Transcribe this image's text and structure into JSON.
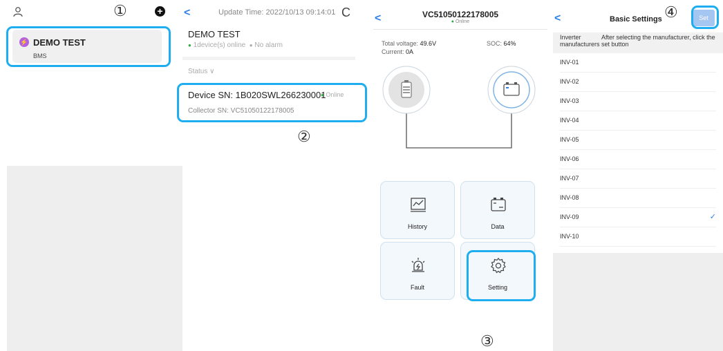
{
  "colors": {
    "accent": "#2b7de9",
    "highlight": "#1eaef0",
    "online_green": "#2fa845",
    "set_button": "#a6c6f2",
    "plant_badge": "#b560e0"
  },
  "annotations": [
    "①",
    "②",
    "③",
    "④"
  ],
  "plant_list": {
    "user_icon": "user-icon",
    "add_icon": "+",
    "plant": {
      "badge_icon": "⚡",
      "name": "DEMO TEST",
      "type": "BMS"
    }
  },
  "plant_detail": {
    "back": "<",
    "update_time_label": "Update Time: 2022/10/13 09:14:01",
    "refresh_icon": "C",
    "title": "DEMO TEST",
    "online_dot": "●",
    "devices_online": "1device(s) online",
    "alarm_dot": "●",
    "alarm": "No alarm",
    "status_label": "Status ∨",
    "device_sn_label": "Device SN:  1B020SWL266230001",
    "device_dot": "●",
    "device_status": "Online",
    "collector_sn_label": "Collector SN:  VC51050122178005"
  },
  "collector": {
    "back": "<",
    "title": "VC51050122178005",
    "status_dot": "●",
    "status": "Online",
    "total_voltage_label": "Total voltage: ",
    "total_voltage": "49.6V",
    "current_label": "Current: ",
    "current": "0A",
    "soc_label": "SOC: ",
    "soc": "64%",
    "tiles": {
      "history": "History",
      "data": "Data",
      "fault": "Fault",
      "setting": "Setting"
    }
  },
  "basic_settings": {
    "back": "<",
    "title": "Basic Settings",
    "set_button": "Set",
    "header_col1": "Inverter manufacturers",
    "header_col2": "After selecting the manufacturer, click the set button",
    "rows": [
      "INV-01",
      "INV-02",
      "INV-03",
      "INV-04",
      "INV-05",
      "INV-06",
      "INV-07",
      "INV-08",
      "INV-09",
      "INV-10"
    ],
    "selected_index": 8,
    "check": "✓"
  }
}
